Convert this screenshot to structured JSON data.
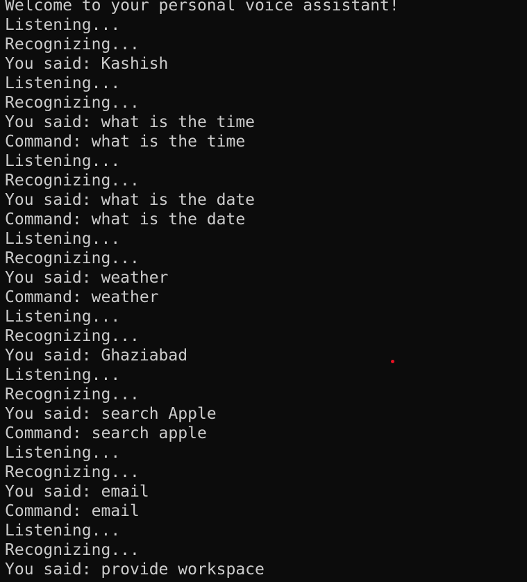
{
  "colors": {
    "background": "#0c0c0c",
    "text": "#cccccc",
    "pointer": "#e81123"
  },
  "terminal": {
    "lines": [
      "Welcome to your personal voice assistant!",
      "Listening...",
      "Recognizing...",
      "You said: Kashish",
      "Listening...",
      "Recognizing...",
      "You said: what is the time",
      "Command: what is the time",
      "Listening...",
      "Recognizing...",
      "You said: what is the date",
      "Command: what is the date",
      "Listening...",
      "Recognizing...",
      "You said: weather",
      "Command: weather",
      "Listening...",
      "Recognizing...",
      "You said: Ghaziabad",
      "Listening...",
      "Recognizing...",
      "You said: search Apple",
      "Command: search apple",
      "Listening...",
      "Recognizing...",
      "You said: email",
      "Command: email",
      "Listening...",
      "Recognizing...",
      "You said: provide workspace"
    ]
  }
}
